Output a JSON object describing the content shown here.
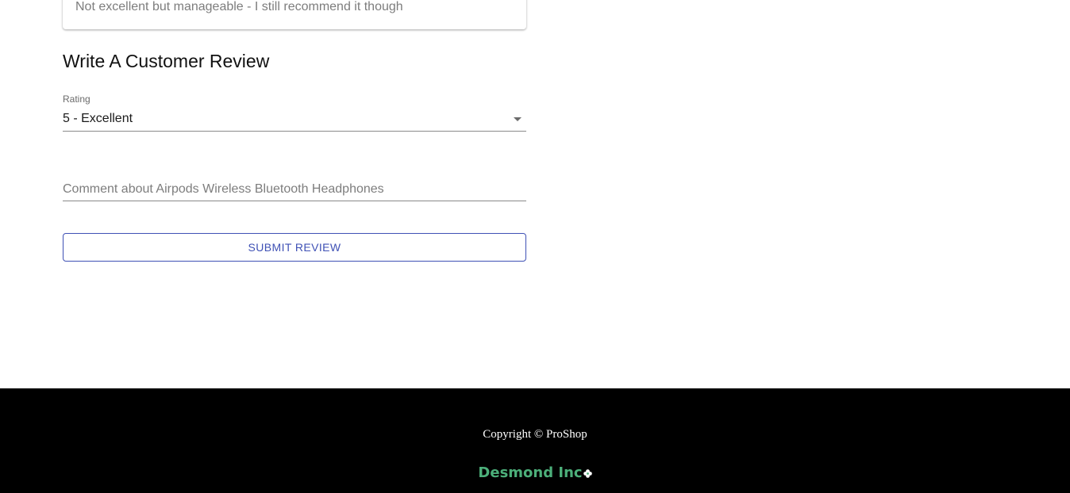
{
  "previous_review": {
    "comment": "Not excellent but manageable - I still recommend it though"
  },
  "review_form": {
    "title": "Write A Customer Review",
    "rating_label": "Rating",
    "rating_value": "5 - Excellent",
    "comment_placeholder": "Comment about Airpods Wireless Bluetooth Headphones",
    "comment_value": "",
    "submit_label": "Submit Review"
  },
  "footer": {
    "copyright": "Copyright © ProShop",
    "brand": "Desmond Inc",
    "brand_icon": "flower-icon"
  },
  "colors": {
    "primary": "#3f51b5",
    "footer_bg": "#000000",
    "brand_green": "#4caf7a"
  }
}
